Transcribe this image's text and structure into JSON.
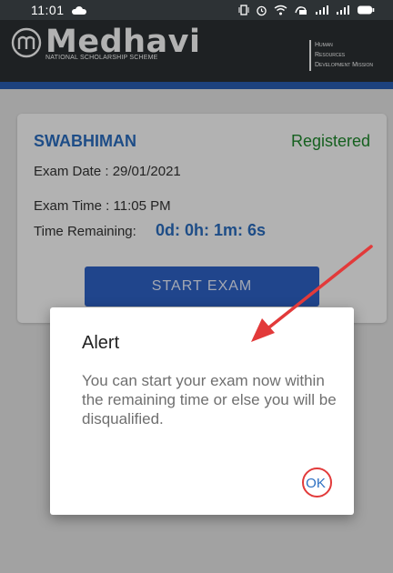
{
  "status_bar": {
    "time": "11:01",
    "icons": [
      "cloud-icon",
      "vibrate-icon",
      "alarm-icon",
      "wifi-icon",
      "volte-icon",
      "signal-icon",
      "signal-icon",
      "battery-icon"
    ]
  },
  "header": {
    "brand": "Medhavi",
    "subtitle": "NATIONAL SCHOLARSHIP SCHEME",
    "ministry_lines": [
      "Human",
      "Resources",
      "Development Mission"
    ]
  },
  "exam_card": {
    "title": "SWABHIMAN",
    "status": "Registered",
    "exam_date": "Exam Date : 29/01/2021",
    "exam_time": "Exam Time : 11:05 PM",
    "time_remaining_label": "Time Remaining:",
    "time_remaining_value": "0d: 0h: 1m: 6s",
    "start_button_label": "START EXAM"
  },
  "alert": {
    "title": "Alert",
    "message": "You can start your exam now within the remaining time or else you will be disqualified.",
    "ok_label": "OK"
  },
  "colors": {
    "accent_blue": "#2c6fc2",
    "registered_green": "#1f8a2d",
    "annotation_red": "#e23a3a",
    "header_dark": "#2b3033"
  }
}
